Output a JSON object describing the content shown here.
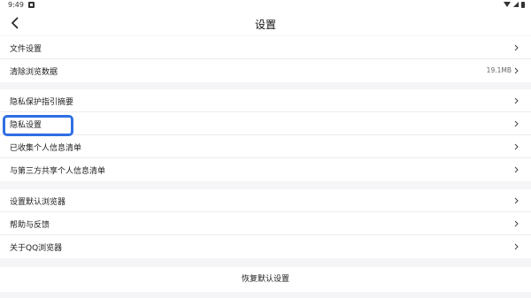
{
  "status_bar": {
    "time": "9:49",
    "icons": [
      "notification-icon",
      "wifi-icon",
      "signal-icon",
      "battery-icon"
    ]
  },
  "nav": {
    "title": "设置",
    "back_icon": "chevron-left-icon"
  },
  "groups": [
    {
      "items": [
        {
          "label": "文件设置",
          "value": ""
        },
        {
          "label": "清除浏览数据",
          "value": "19.1MB"
        }
      ]
    },
    {
      "items": [
        {
          "label": "隐私保护指引摘要",
          "value": ""
        },
        {
          "label": "隐私设置",
          "value": "",
          "highlighted": true
        },
        {
          "label": "已收集个人信息清单",
          "value": ""
        },
        {
          "label": "与第三方共享个人信息清单",
          "value": ""
        }
      ]
    },
    {
      "items": [
        {
          "label": "设置默认浏览器",
          "value": ""
        },
        {
          "label": "帮助与反馈",
          "value": ""
        },
        {
          "label": "关于QQ浏览器",
          "value": ""
        }
      ]
    }
  ],
  "restore_label": "恢复默认设置",
  "colors": {
    "highlight": "#2f6fe4",
    "background": "#f5f5f7",
    "surface": "#ffffff"
  }
}
